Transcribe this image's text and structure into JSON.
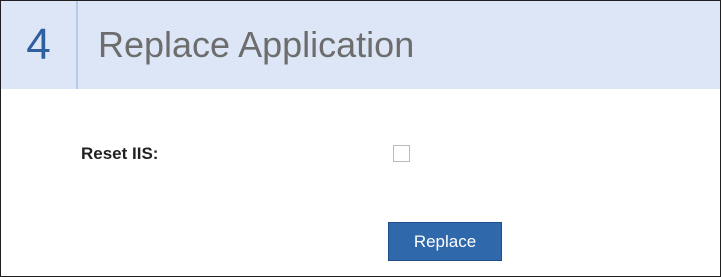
{
  "section": {
    "step_number": "4",
    "title": "Replace Application"
  },
  "form": {
    "reset_iis_label": "Reset IIS:",
    "reset_iis_checked": false,
    "replace_button_label": "Replace"
  },
  "colors": {
    "header_background": "#dce6f6",
    "step_number": "#2f5f9e",
    "button_background": "#2f68ab"
  }
}
